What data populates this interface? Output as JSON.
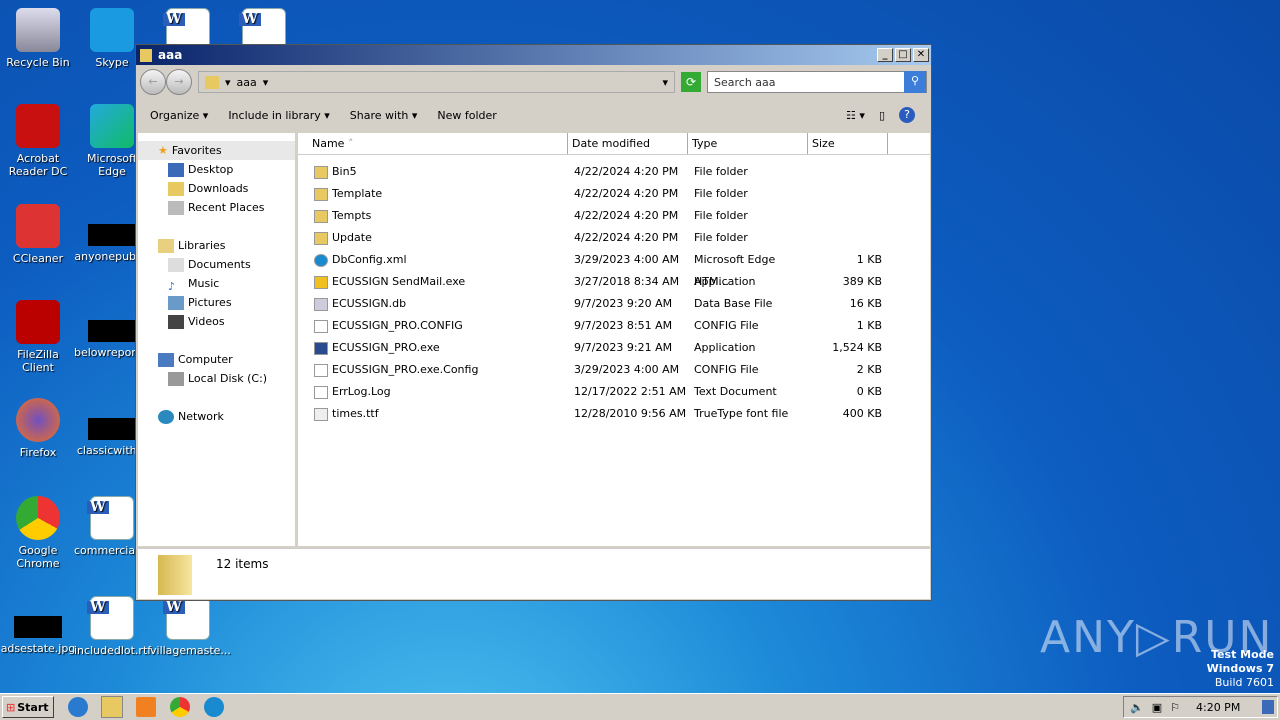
{
  "desktop": {
    "icons": [
      {
        "label": "Recycle Bin",
        "kind": "recycle"
      },
      {
        "label": "Skype",
        "kind": "skype"
      },
      {
        "label": "Acrobat Reader DC",
        "kind": "acrobat"
      },
      {
        "label": "Microsoft Edge",
        "kind": "edge"
      },
      {
        "label": "CCleaner",
        "kind": "ccleaner"
      },
      {
        "label": "anyonepubl...",
        "kind": "black"
      },
      {
        "label": "FileZilla Client",
        "kind": "filezilla"
      },
      {
        "label": "belowreport...",
        "kind": "black"
      },
      {
        "label": "Firefox",
        "kind": "firefox"
      },
      {
        "label": "classicwith...",
        "kind": "black"
      },
      {
        "label": "Google Chrome",
        "kind": "chrome"
      },
      {
        "label": "commerciala...",
        "kind": "doc"
      },
      {
        "label": "adsestate.jpg",
        "kind": "black"
      },
      {
        "label": "includedlot.rtf",
        "kind": "doc"
      },
      {
        "label": "villagemaste...",
        "kind": "doc"
      }
    ]
  },
  "window": {
    "title": "aaa",
    "path": "aaa",
    "search_placeholder": "Search aaa",
    "toolbar": {
      "organize": "Organize",
      "include": "Include in library",
      "share": "Share with",
      "new_folder": "New folder"
    },
    "nav": {
      "favorites": "Favorites",
      "desktop": "Desktop",
      "downloads": "Downloads",
      "recent": "Recent Places",
      "libraries": "Libraries",
      "documents": "Documents",
      "music": "Music",
      "pictures": "Pictures",
      "videos": "Videos",
      "computer": "Computer",
      "local_disk": "Local Disk (C:)",
      "network": "Network"
    },
    "columns": {
      "name": "Name",
      "date": "Date modified",
      "type": "Type",
      "size": "Size"
    },
    "files": [
      {
        "name": "Bin5",
        "date": "4/22/2024 4:20 PM",
        "type": "File folder",
        "size": "",
        "icon": "folder"
      },
      {
        "name": "Template",
        "date": "4/22/2024 4:20 PM",
        "type": "File folder",
        "size": "",
        "icon": "folder"
      },
      {
        "name": "Tempts",
        "date": "4/22/2024 4:20 PM",
        "type": "File folder",
        "size": "",
        "icon": "folder"
      },
      {
        "name": "Update",
        "date": "4/22/2024 4:20 PM",
        "type": "File folder",
        "size": "",
        "icon": "folder"
      },
      {
        "name": "DbConfig.xml",
        "date": "3/29/2023 4:00 AM",
        "type": "Microsoft Edge HTM...",
        "size": "1 KB",
        "icon": "edge"
      },
      {
        "name": "ECUSSIGN SendMail.exe",
        "date": "3/27/2018 8:34 AM",
        "type": "Application",
        "size": "389 KB",
        "icon": "mail"
      },
      {
        "name": "ECUSSIGN.db",
        "date": "9/7/2023 9:20 AM",
        "type": "Data Base File",
        "size": "16 KB",
        "icon": "db"
      },
      {
        "name": "ECUSSIGN_PRO.CONFIG",
        "date": "9/7/2023 8:51 AM",
        "type": "CONFIG File",
        "size": "1 KB",
        "icon": "file"
      },
      {
        "name": "ECUSSIGN_PRO.exe",
        "date": "9/7/2023 9:21 AM",
        "type": "Application",
        "size": "1,524 KB",
        "icon": "app"
      },
      {
        "name": "ECUSSIGN_PRO.exe.Config",
        "date": "3/29/2023 4:00 AM",
        "type": "CONFIG File",
        "size": "2 KB",
        "icon": "file"
      },
      {
        "name": "ErrLog.Log",
        "date": "12/17/2022 2:51 AM",
        "type": "Text Document",
        "size": "0 KB",
        "icon": "file"
      },
      {
        "name": "times.ttf",
        "date": "12/28/2010 9:56 AM",
        "type": "TrueType font file",
        "size": "400 KB",
        "icon": "font"
      }
    ],
    "status": "12 items"
  },
  "taskbar": {
    "start": "Start",
    "clock": "4:20 PM"
  },
  "watermark": {
    "line1": "Test Mode",
    "line2": "Windows 7",
    "line3": "Build 7601",
    "logo": "ANY RUN"
  }
}
